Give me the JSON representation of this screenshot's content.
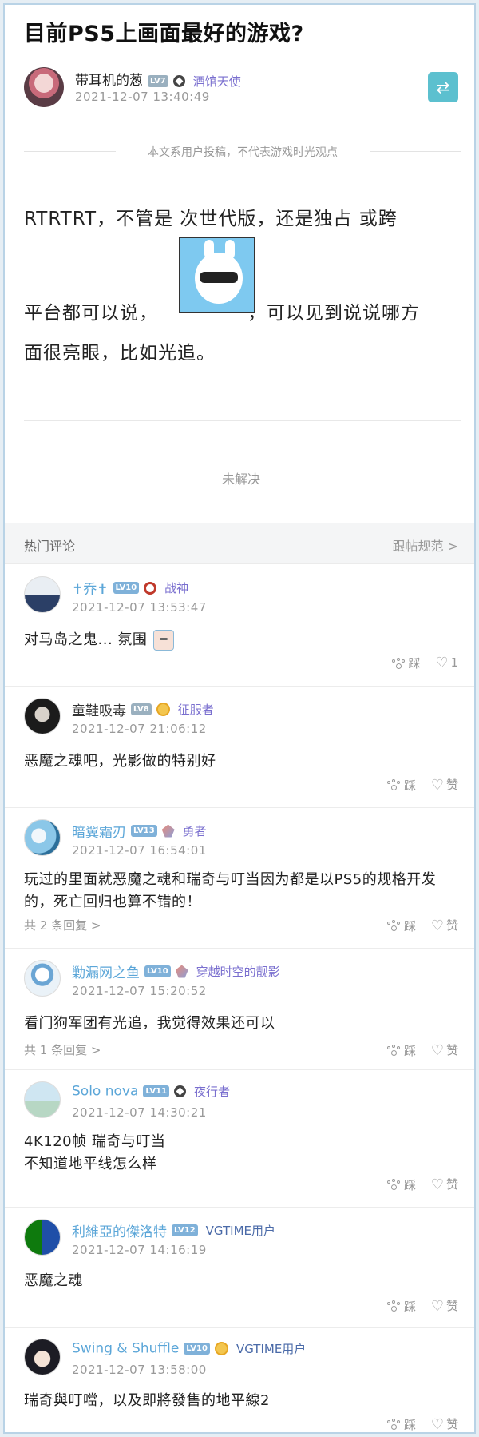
{
  "post": {
    "title": "目前PS5上画面最好的游戏?",
    "author": {
      "name": "带耳机的葱",
      "level": "LV7",
      "tag": "酒馆天使",
      "time": "2021-12-07 13:40:49"
    },
    "swap_icon": "swap-arrows-icon",
    "disclaimer": "本文系用户投稿，不代表游戏时光观点",
    "body": {
      "line1": "RTRTRT，不管是 次世代版，还是独占 或跨",
      "line2a": "平台都可以说，",
      "line2b": "，可以见到说说哪方",
      "line3": "面很亮眼，比如光追。"
    },
    "status": "未解决"
  },
  "comments_header": {
    "title": "热门评论",
    "rules_link": "跟帖规范 >"
  },
  "comments": [
    {
      "name": "✝乔✝",
      "level": "LV10",
      "tag": "战神",
      "time": "2021-12-07 13:53:47",
      "text": "对马岛之鬼... 氛围",
      "replies": "",
      "dislike": "踩",
      "like": "1"
    },
    {
      "name": "童鞋吸毒",
      "level": "LV8",
      "tag": "征服者",
      "time": "2021-12-07 21:06:12",
      "text": "恶魔之魂吧，光影做的特别好",
      "replies": "",
      "dislike": "踩",
      "like": "赞"
    },
    {
      "name": "暗翼霜刃",
      "level": "LV13",
      "tag": "勇者",
      "time": "2021-12-07 16:54:01",
      "text": "玩过的里面就恶魔之魂和瑞奇与叮当因为都是以PS5的规格开发的，死亡回归也算不错的！",
      "replies": "共 2 条回复 >",
      "dislike": "踩",
      "like": "赞"
    },
    {
      "name": "勦漏网之鱼",
      "level": "LV10",
      "tag": "穿越时空的靓影",
      "time": "2021-12-07 15:20:52",
      "text": "看门狗军团有光追，我觉得效果还可以",
      "replies": "共 1 条回复 >",
      "dislike": "踩",
      "like": "赞"
    },
    {
      "name": "Solo nova",
      "level": "LV11",
      "tag": "夜行者",
      "time": "2021-12-07 14:30:21",
      "text": "4K120帧 瑞奇与叮当\n不知道地平线怎么样",
      "replies": "",
      "dislike": "踩",
      "like": "赞"
    },
    {
      "name": "利維亞的傑洛特",
      "level": "LV12",
      "tag": "VGTIME用户",
      "time": "2021-12-07 14:16:19",
      "text": "恶魔之魂",
      "replies": "",
      "dislike": "踩",
      "like": "赞"
    },
    {
      "name": "Swing & Shuffle",
      "level": "LV10",
      "tag": "VGTIME用户",
      "time": "2021-12-07 13:58:00",
      "text": "瑞奇與叮噹，以及即將發售的地平線2",
      "replies": "",
      "dislike": "踩",
      "like": "赞"
    }
  ]
}
